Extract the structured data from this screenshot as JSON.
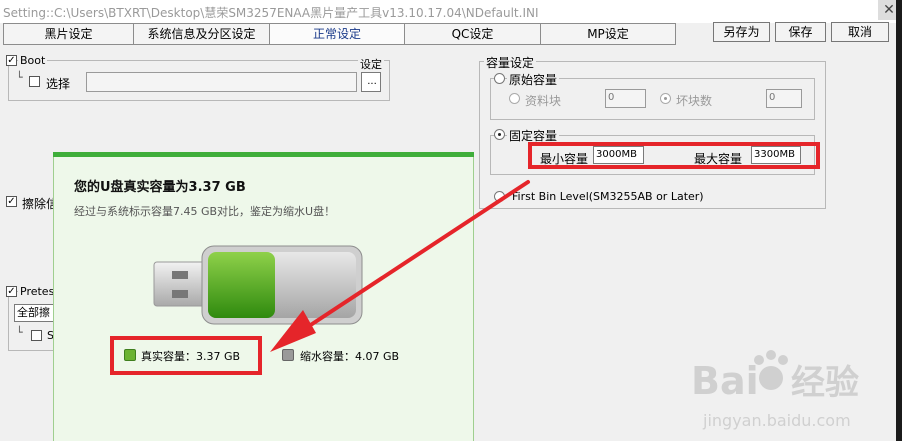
{
  "window": {
    "title": "Setting::C:\\Users\\BTXRT\\Desktop\\慧荣SM3257ENAA黑片量产工具v13.10.17.04\\NDefault.INI",
    "close_glyph": "✕"
  },
  "tabs": [
    {
      "label": "黑片设定"
    },
    {
      "label": "系统信息及分区设定"
    },
    {
      "label": "正常设定"
    },
    {
      "label": "QC设定"
    },
    {
      "label": "MP设定"
    }
  ],
  "active_tab": "正常设定",
  "toolbar": {
    "save_as": "另存为",
    "save": "保存",
    "cancel": "取消"
  },
  "boot": {
    "group_label": "Boot",
    "checked_mark": "✓",
    "tree_glyph": "└",
    "select_label": "选择",
    "settings_label": "设定",
    "browse_label": "..."
  },
  "left_partial": {
    "erase_label": "擦除信",
    "pretest_label": "Pretest",
    "combo_value": "全部擦",
    "sub_label": "S"
  },
  "capacity": {
    "group_label": "容量设定",
    "original": {
      "label": "原始容量",
      "material_label": "资料块",
      "material_value": "0",
      "bad_label": "坏块数",
      "bad_value": "0"
    },
    "fixed": {
      "label": "固定容量",
      "min_label": "最小容量",
      "min_value": "3000MB",
      "max_label": "最大容量",
      "max_value": "3300MB"
    },
    "first_bin_label": "First Bin Level(SM3255AB or Later)"
  },
  "popup": {
    "title": "您的U盘真实容量为3.37 GB",
    "description": "经过与系统标示容量7.45 GB对比，鉴定为缩水U盘！",
    "real_capacity": "真实容量：3.37 GB",
    "shrunk_capacity": "缩水容量：4.07 GB",
    "real_fraction": 0.45,
    "colors": {
      "real": "#6bb332",
      "shrunk": "#9a9a9a",
      "accent": "#3fae3a"
    }
  },
  "annotation_color": "#e5252a",
  "watermark": {
    "brand_left": "Bai",
    "brand_right": "经验",
    "url": "jingyan.baidu.com"
  }
}
